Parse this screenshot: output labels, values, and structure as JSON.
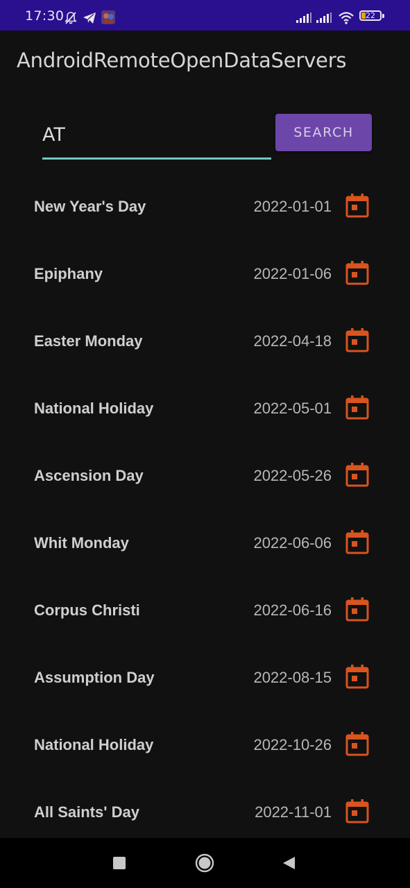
{
  "status_bar": {
    "time": "17:30",
    "battery_level": "22",
    "battery_fraction": 0.22,
    "icons": [
      "mute-bell-icon",
      "telegram-icon",
      "avatar-app-icon",
      "signal-icon",
      "signal-icon",
      "wifi-icon",
      "battery-icon"
    ],
    "background_color": "#2a0f8f"
  },
  "app_bar": {
    "title": "AndroidRemoteOpenDataServers"
  },
  "search": {
    "value": "AT",
    "button_label": "SEARCH",
    "button_color": "#6c46a8",
    "underline_color": "#73c7c0"
  },
  "holidays": [
    {
      "name": "New Year's Day",
      "date": "2022-01-01"
    },
    {
      "name": "Epiphany",
      "date": "2022-01-06"
    },
    {
      "name": "Easter Monday",
      "date": "2022-04-18"
    },
    {
      "name": "National Holiday",
      "date": "2022-05-01"
    },
    {
      "name": "Ascension Day",
      "date": "2022-05-26"
    },
    {
      "name": "Whit Monday",
      "date": "2022-06-06"
    },
    {
      "name": "Corpus Christi",
      "date": "2022-06-16"
    },
    {
      "name": "Assumption Day",
      "date": "2022-08-15"
    },
    {
      "name": "National Holiday",
      "date": "2022-10-26"
    },
    {
      "name": "All Saints' Day",
      "date": "2022-11-01"
    }
  ],
  "calendar_icon": {
    "name": "calendar-icon",
    "color": "#d9541e"
  },
  "nav_bar": {
    "icons": [
      "recents-icon",
      "home-icon",
      "back-icon"
    ]
  }
}
